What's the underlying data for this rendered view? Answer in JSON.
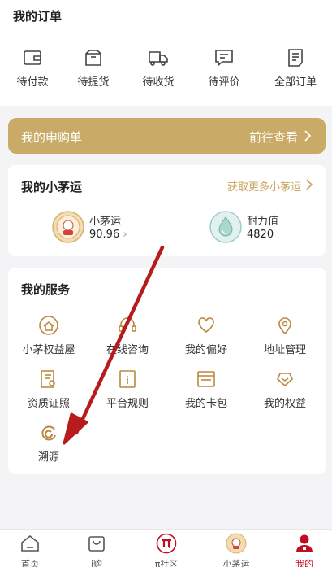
{
  "orders": {
    "title": "我的订单",
    "items": [
      {
        "label": "待付款",
        "icon": "wallet-icon"
      },
      {
        "label": "待提货",
        "icon": "package-icon"
      },
      {
        "label": "待收货",
        "icon": "truck-icon"
      },
      {
        "label": "待评价",
        "icon": "comment-icon"
      },
      {
        "label": "全部订单",
        "icon": "orders-list-icon"
      }
    ]
  },
  "apply": {
    "title": "我的申购单",
    "action": "前往查看"
  },
  "luck": {
    "title": "我的小茅运",
    "more": "获取更多小茅运",
    "stats": [
      {
        "name": "小茅运",
        "value": "90.96",
        "icon": "xiaomao-medal-icon"
      },
      {
        "name": "耐力值",
        "value": "4820",
        "icon": "water-drop-icon"
      }
    ]
  },
  "services": {
    "title": "我的服务",
    "items": [
      {
        "label": "小茅权益屋",
        "icon": "benefit-house-icon"
      },
      {
        "label": "在线咨询",
        "icon": "headset-icon"
      },
      {
        "label": "我的偏好",
        "icon": "heart-icon"
      },
      {
        "label": "地址管理",
        "icon": "location-pin-icon"
      },
      {
        "label": "资质证照",
        "icon": "certificate-icon"
      },
      {
        "label": "平台规则",
        "icon": "rules-icon"
      },
      {
        "label": "我的卡包",
        "icon": "card-wallet-icon"
      },
      {
        "label": "我的权益",
        "icon": "rights-badge-icon"
      },
      {
        "label": "溯源",
        "icon": "trace-icon"
      }
    ]
  },
  "nav": {
    "items": [
      {
        "label": "首页",
        "icon": "home-icon"
      },
      {
        "label": "i购",
        "icon": "shopping-bag-icon"
      },
      {
        "label": "π社区",
        "icon": "pi-community-icon"
      },
      {
        "label": "小茅运",
        "icon": "xiaomao-icon"
      },
      {
        "label": "我的",
        "icon": "profile-icon"
      }
    ],
    "active": "我的"
  },
  "colors": {
    "accent_gold": "#c9aa67",
    "brand_red": "#c00d20",
    "annotation_red": "#b71c1c"
  }
}
